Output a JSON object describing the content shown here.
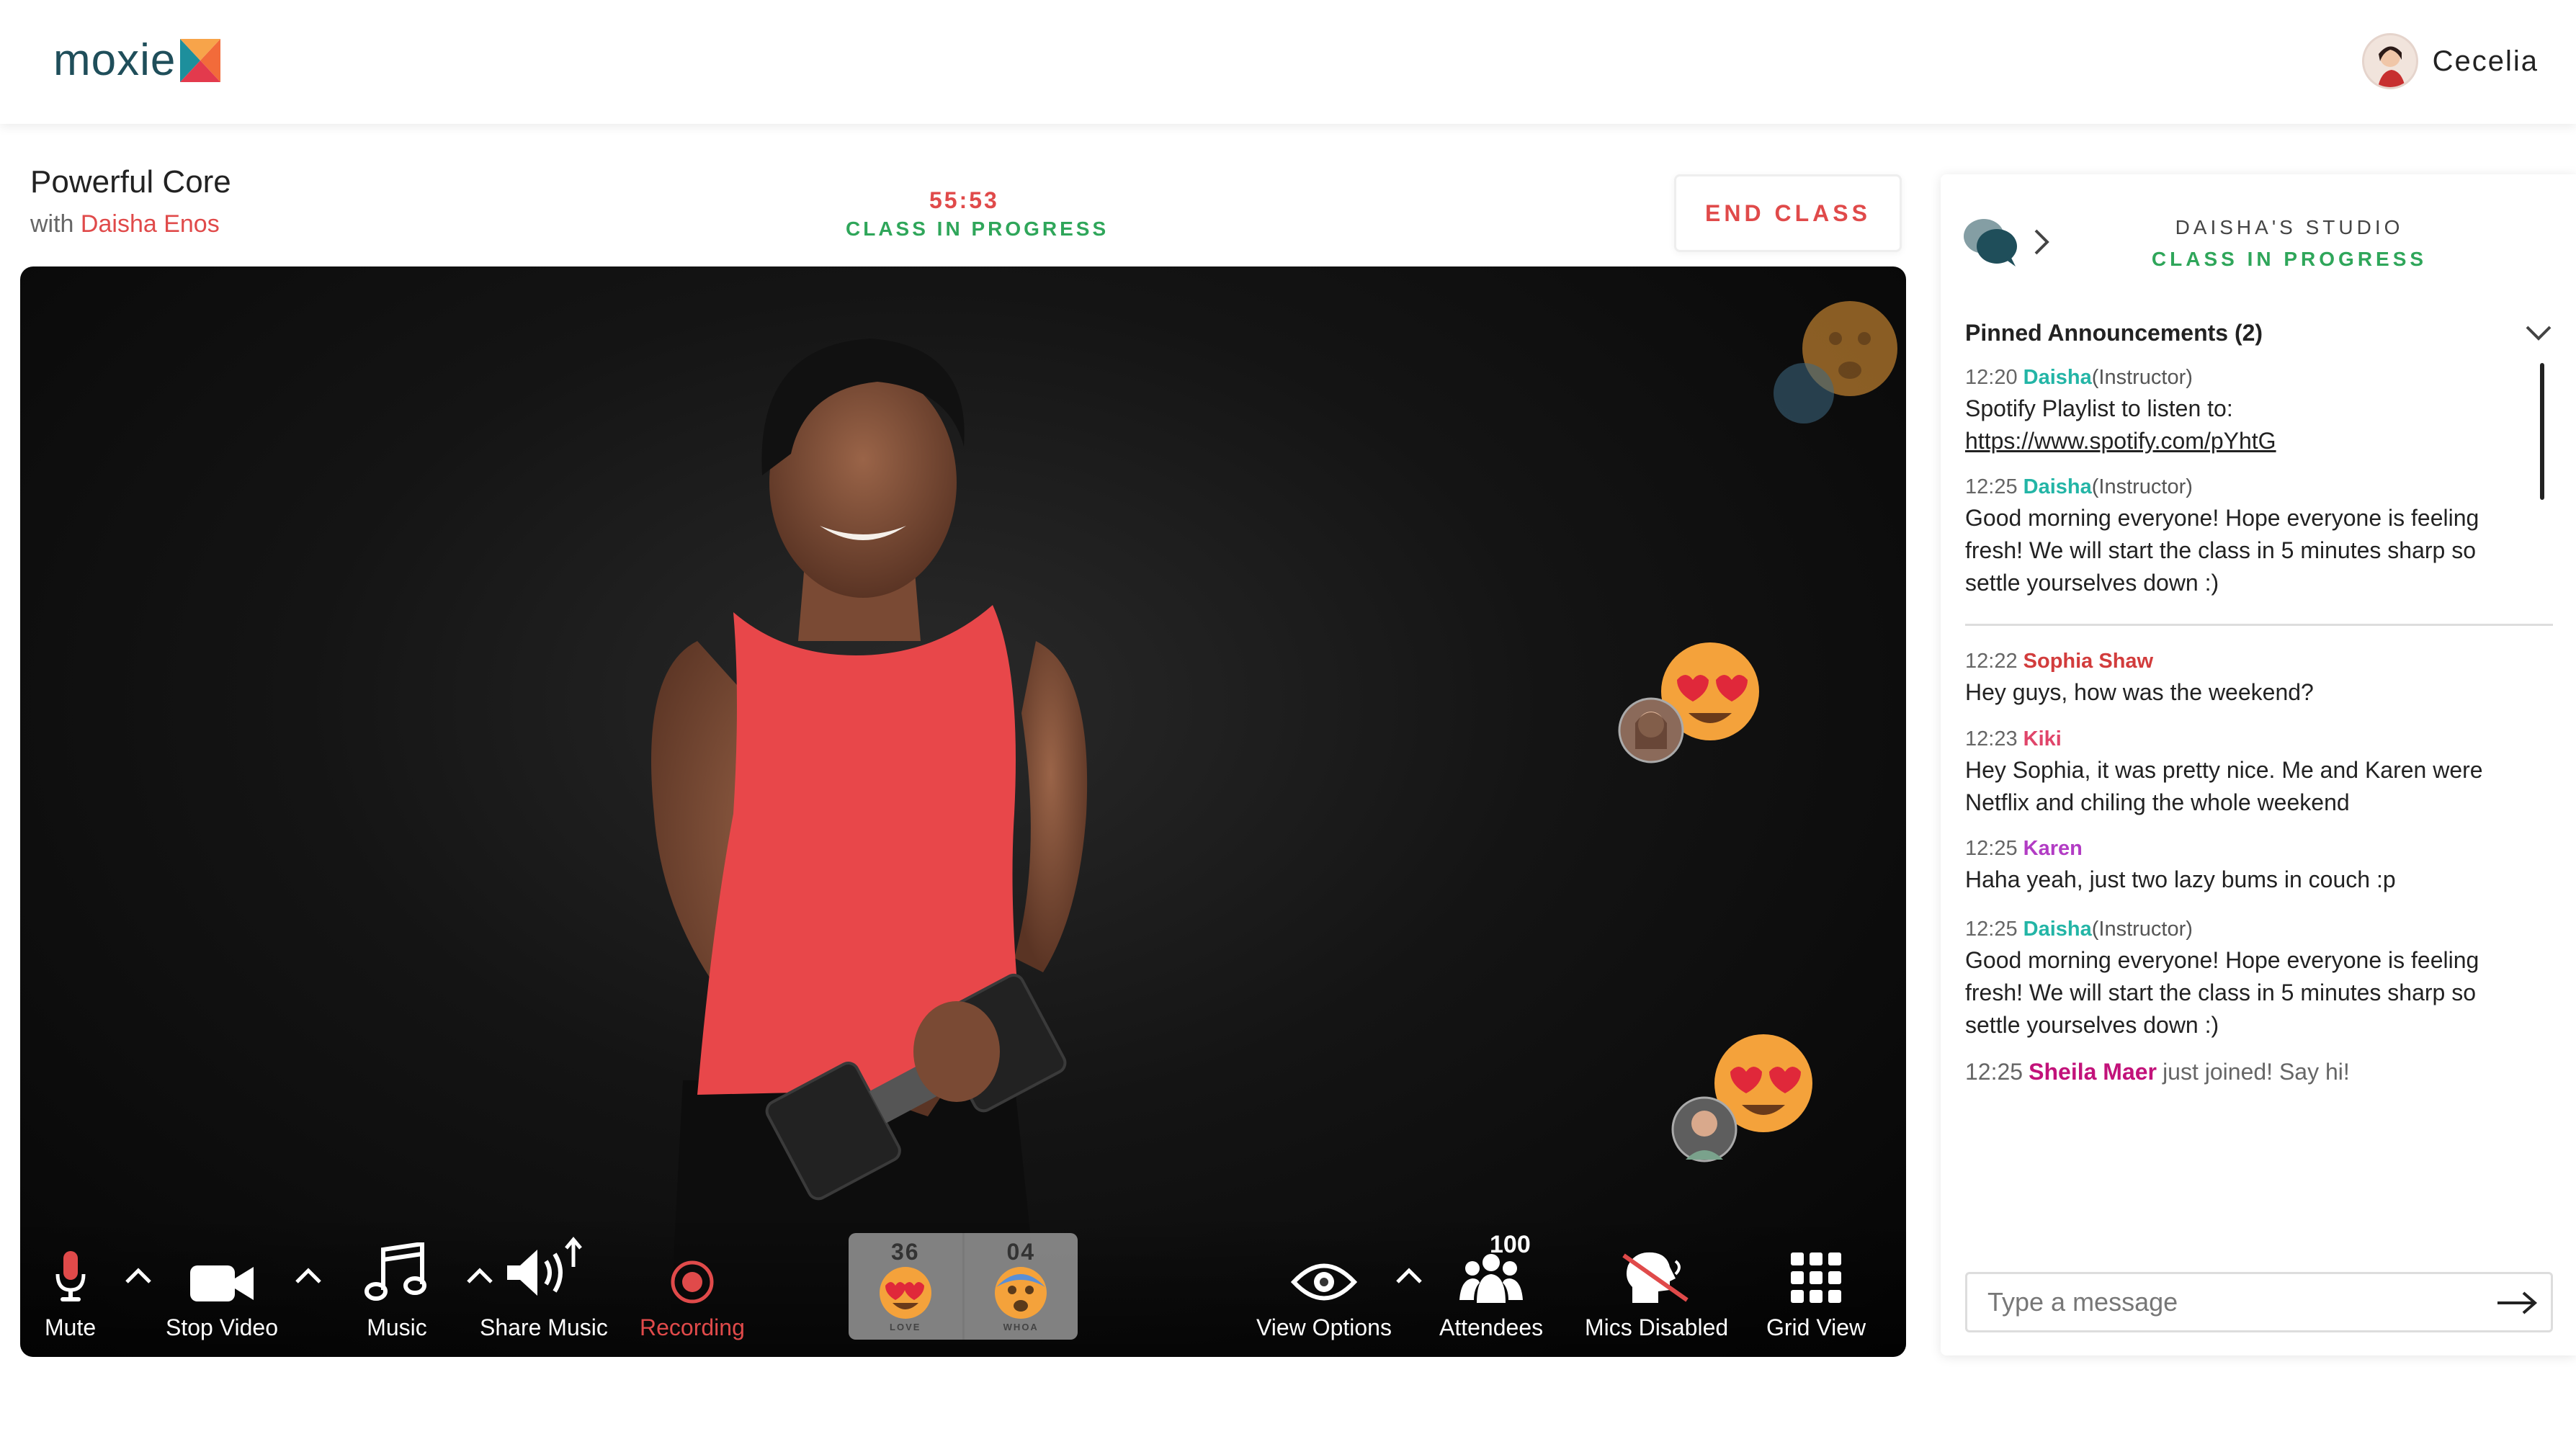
{
  "brand": {
    "name": "moxie"
  },
  "user": {
    "name": "Cecelia"
  },
  "class_info": {
    "title": "Powerful Core",
    "with_prefix": "with",
    "instructor": "Daisha Enos",
    "timer": "55:53",
    "status": "CLASS IN PROGRESS",
    "end_label": "END CLASS"
  },
  "controls": {
    "mute": "Mute",
    "stop_video": "Stop Video",
    "music": "Music",
    "share_music": "Share Music",
    "recording": "Recording",
    "view_options": "View Options",
    "attendees": "Attendees",
    "attendees_count": "100",
    "mics_disabled": "Mics Disabled",
    "grid_view": "Grid View"
  },
  "reactions": [
    {
      "count": "36",
      "label": "LOVE"
    },
    {
      "count": "04",
      "label": "WHOA"
    }
  ],
  "chat": {
    "studio": "DAISHA'S STUDIO",
    "status": "CLASS IN PROGRESS",
    "pinned_title": "Pinned Announcements (2)",
    "pinned": [
      {
        "time": "12:20",
        "name": "Daisha",
        "role": "(Instructor)",
        "text": "Spotify Playlist to listen to:",
        "link": "https://www.spotify.com/pYhtG"
      },
      {
        "time": "12:25",
        "name": "Daisha",
        "role": "(Instructor)",
        "text": "Good morning everyone! Hope everyone is feeling fresh! We will start the class in 5 minutes sharp so settle yourselves down :)"
      }
    ],
    "messages": [
      {
        "time": "12:22",
        "name": "Sophia Shaw",
        "text": "Hey guys, how was the weekend?"
      },
      {
        "time": "12:23",
        "name": "Kiki",
        "text": "Hey Sophia, it was pretty nice. Me and Karen were Netflix and chiling the whole weekend"
      },
      {
        "time": "12:25",
        "name": "Karen",
        "text": "Haha yeah, just two lazy bums in couch :p"
      },
      {
        "time": "12:25",
        "name": "Daisha",
        "role": "(Instructor)",
        "text": "Good morning everyone! Hope everyone is feeling fresh! We will start the class in 5 minutes sharp so settle yourselves down :)"
      },
      {
        "time": "12:25",
        "name": "Sheila Maer",
        "text": "just joined! Say hi!"
      }
    ],
    "input_placeholder": "Type a message"
  },
  "colors": {
    "accent_red": "#e04a4a",
    "status_green": "#2fa65a",
    "instructor_teal": "#23b5a6",
    "sophia": "#d23c3c",
    "kiki": "#e0456a",
    "karen": "#b23cc4",
    "sheila": "#c2127a"
  }
}
